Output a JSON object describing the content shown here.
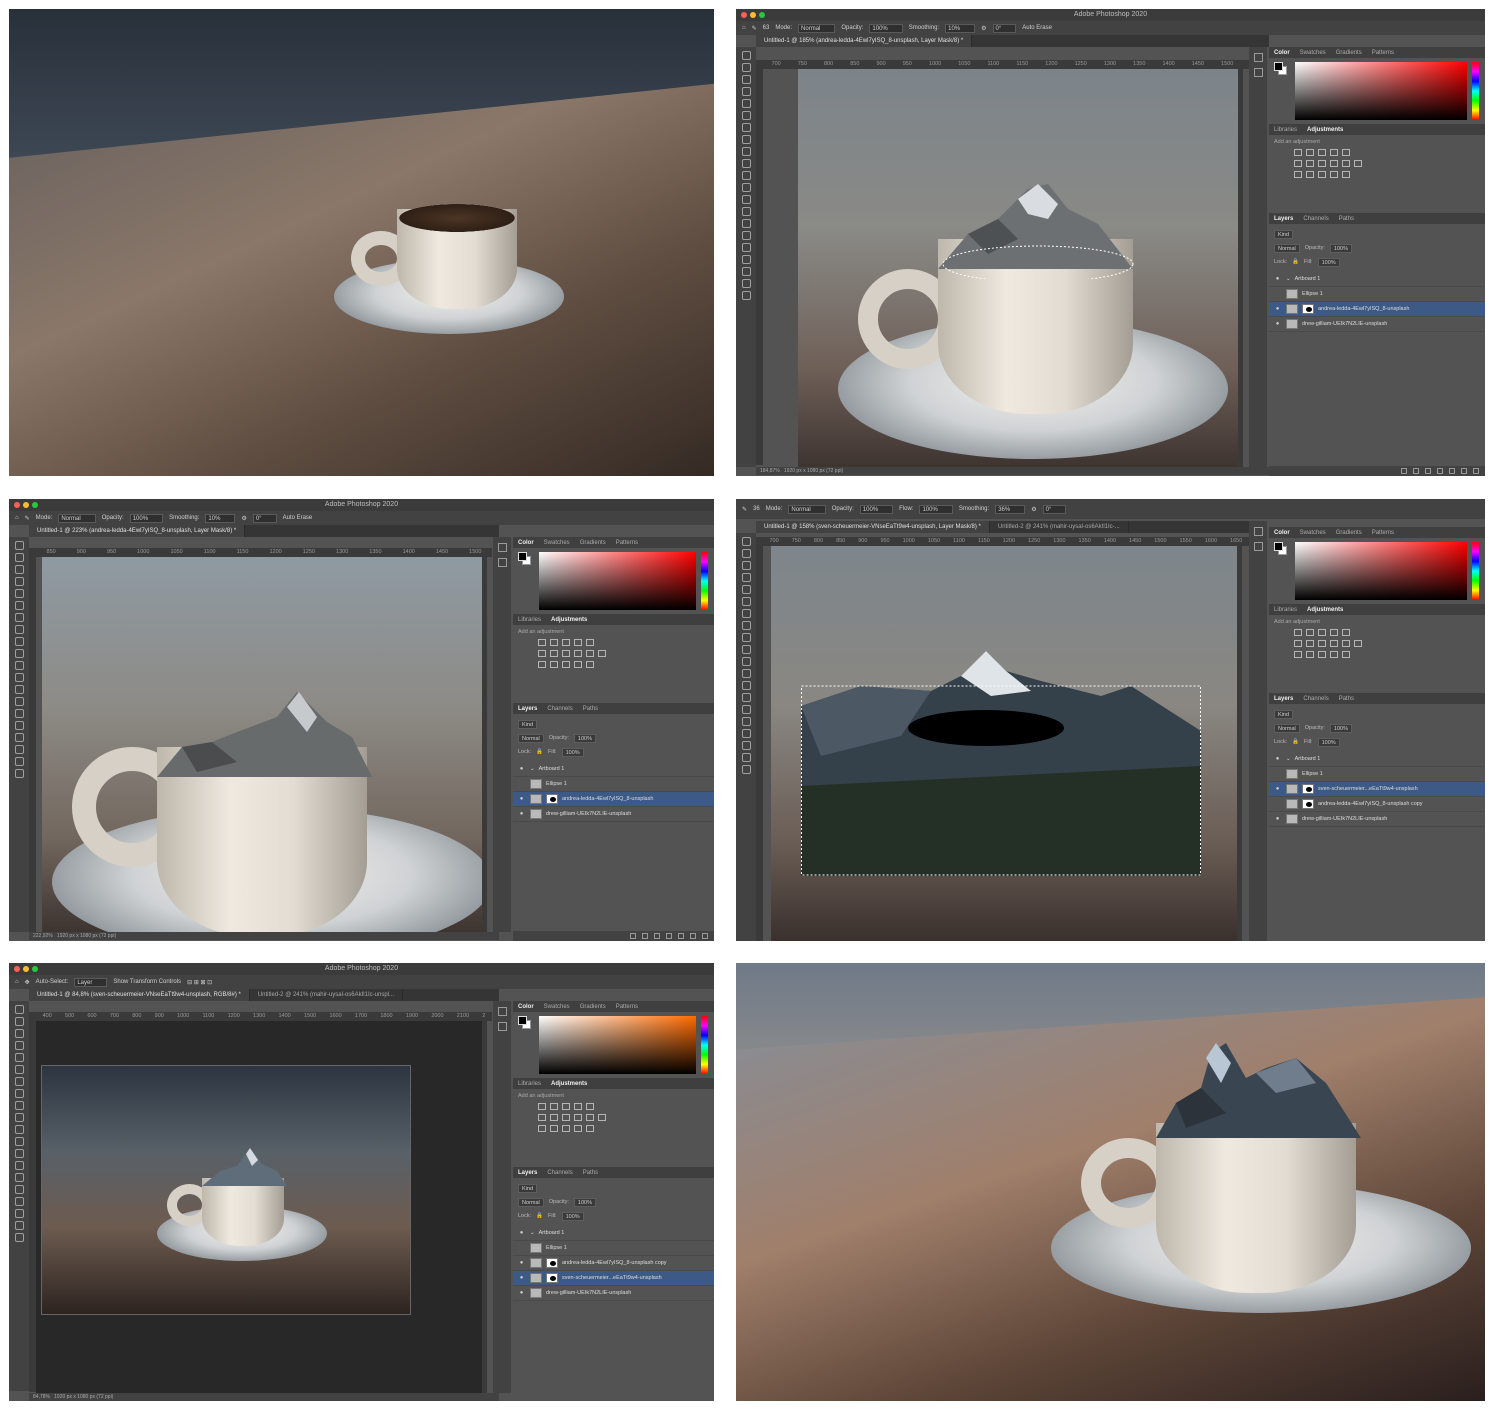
{
  "app_title": "Adobe Photoshop 2020",
  "window_buttons": {
    "close_color": "#ff5f57",
    "minimize_color": "#febc2e",
    "zoom_color": "#28c840"
  },
  "panel2": {
    "options": {
      "mode_label": "Mode:",
      "mode_value": "Normal",
      "opacity_label": "Opacity:",
      "opacity_value": "100%",
      "smoothing_label": "Smoothing:",
      "smoothing_value": "10%",
      "angle_value": "0°",
      "auto_erase": "Auto Erase",
      "brush_size": "63"
    },
    "doc_tab": "Untitled-1 @ 185% (andrea-ledda-4Ewl7yISQ_8-unsplash, Layer Mask/8) *",
    "ruler": [
      "700",
      "750",
      "800",
      "850",
      "900",
      "950",
      "1000",
      "1050",
      "1100",
      "1150",
      "1200",
      "1250",
      "1300",
      "1350",
      "1400",
      "1450",
      "1500",
      "1"
    ],
    "status_zoom": "184,87%",
    "status_doc": "1920 px x 1080 px (72 ppi)",
    "color_tabs": [
      "Color",
      "Swatches",
      "Gradients",
      "Patterns"
    ],
    "adj_tabs": [
      "Libraries",
      "Adjustments"
    ],
    "add_adjustment": "Add an adjustment",
    "layer_tabs": [
      "Layers",
      "Channels",
      "Paths"
    ],
    "kind": "Kind",
    "blend": "Normal",
    "opacity_label": "Opacity:",
    "opacity": "100%",
    "lock_label": "Lock:",
    "fill_label": "Fill:",
    "fill": "100%",
    "layers": [
      "Artboard 1",
      "Ellipse 1",
      "andrea-ledda-4Ewl7yISQ_8-unsplash",
      "drew-gilliam-UEIk7N2LIE-unsplash"
    ]
  },
  "panel3": {
    "options": {
      "mode_label": "Mode:",
      "mode_value": "Normal",
      "opacity_label": "Opacity:",
      "opacity_value": "100%",
      "smoothing_label": "Smoothing:",
      "smoothing_value": "10%",
      "angle_value": "0°",
      "auto_erase": "Auto Erase"
    },
    "doc_tab": "Untitled-1 @ 223% (andrea-ledda-4Ewl7yISQ_8-unsplash, Layer Mask/8) *",
    "ruler": [
      "850",
      "900",
      "950",
      "1000",
      "1050",
      "1100",
      "1150",
      "1200",
      "1250",
      "1300",
      "1350",
      "1400",
      "1450",
      "1500"
    ],
    "status_zoom": "222,92%",
    "status_doc": "1920 px x 1080 px (72 ppi)",
    "color_tabs": [
      "Color",
      "Swatches",
      "Gradients",
      "Patterns"
    ],
    "adj_tabs": [
      "Libraries",
      "Adjustments"
    ],
    "add_adjustment": "Add an adjustment",
    "layer_tabs": [
      "Layers",
      "Channels",
      "Paths"
    ],
    "kind": "Kind",
    "blend": "Normal",
    "opacity_label": "Opacity:",
    "opacity": "100%",
    "lock_label": "Lock:",
    "fill_label": "Fill:",
    "fill": "100%",
    "layers": [
      "Artboard 1",
      "Ellipse 1",
      "andrea-ledda-4Ewl7yISQ_8-unsplash",
      "drew-gilliam-UEIk7N2LIE-unsplash"
    ]
  },
  "panel4": {
    "options": {
      "mode_label": "Mode:",
      "mode_value": "Normal",
      "opacity_label": "Opacity:",
      "opacity_value": "100%",
      "flow_label": "Flow:",
      "flow_value": "100%",
      "smoothing_label": "Smoothing:",
      "smoothing_value": "36%",
      "angle_value": "0°",
      "brush_size": "36"
    },
    "doc_tab": "Untitled-1 @ 158% (sven-scheuermeier-VNseEaTt9w4-unsplash, Layer Mask/8) *",
    "doc_tab2": "Untitled-2 @ 241% (mahir-uysal-os6AkIl1Ic-...",
    "ruler": [
      "700",
      "750",
      "800",
      "850",
      "900",
      "950",
      "1000",
      "1050",
      "1100",
      "1150",
      "1200",
      "1250",
      "1300",
      "1350",
      "1400",
      "1450",
      "1500",
      "1550",
      "1600",
      "1650"
    ],
    "color_tabs": [
      "Color",
      "Swatches",
      "Gradients",
      "Patterns"
    ],
    "adj_tabs": [
      "Libraries",
      "Adjustments"
    ],
    "add_adjustment": "Add an adjustment",
    "layer_tabs": [
      "Layers",
      "Channels",
      "Paths"
    ],
    "kind": "Kind",
    "blend": "Normal",
    "opacity_label": "Opacity:",
    "opacity": "100%",
    "lock_label": "Lock:",
    "fill_label": "Fill:",
    "fill": "100%",
    "layers": [
      "Artboard 1",
      "Ellipse 1",
      "sven-scheuermeier...eEaTt9w4-unsplash",
      "andrea-ledda-4Ewl7yISQ_8-unsplash copy",
      "drew-gilliam-UEIk7N2LIE-unsplash"
    ]
  },
  "panel5": {
    "options": {
      "auto_select": "Auto-Select:",
      "auto_select_value": "Layer",
      "show_transform": "Show Transform Controls"
    },
    "doc_tab": "Untitled-1 @ 84,8% (sven-scheuermeier-VNseEaTt9w4-unsplash, RGB/8#) *",
    "doc_tab2": "Untitled-2 @ 241% (mahir-uysal-os6AkIl1Ic-unspl...",
    "ruler": [
      "400",
      "500",
      "600",
      "700",
      "800",
      "900",
      "1000",
      "1100",
      "1200",
      "1300",
      "1400",
      "1500",
      "1600",
      "1700",
      "1800",
      "1900",
      "2000",
      "2100",
      "2"
    ],
    "status_zoom": "84,78%",
    "status_doc": "1920 px x 1080 px (72 ppi)",
    "color_tabs": [
      "Color",
      "Swatches",
      "Gradients",
      "Patterns"
    ],
    "adj_tabs": [
      "Libraries",
      "Adjustments"
    ],
    "add_adjustment": "Add an adjustment",
    "layer_tabs": [
      "Layers",
      "Channels",
      "Paths"
    ],
    "kind": "Kind",
    "blend": "Normal",
    "opacity_label": "Opacity:",
    "opacity": "100%",
    "lock_label": "Lock:",
    "fill_label": "Fill:",
    "fill": "100%",
    "layers": [
      "Artboard 1",
      "Ellipse 1",
      "andrea-ledda-4Ewl7yISQ_8-unsplash copy",
      "sven-scheuermeier...eEaTt9w4-unsplash",
      "drew-gilliam-UEIk7N2LIE-unsplash"
    ]
  }
}
